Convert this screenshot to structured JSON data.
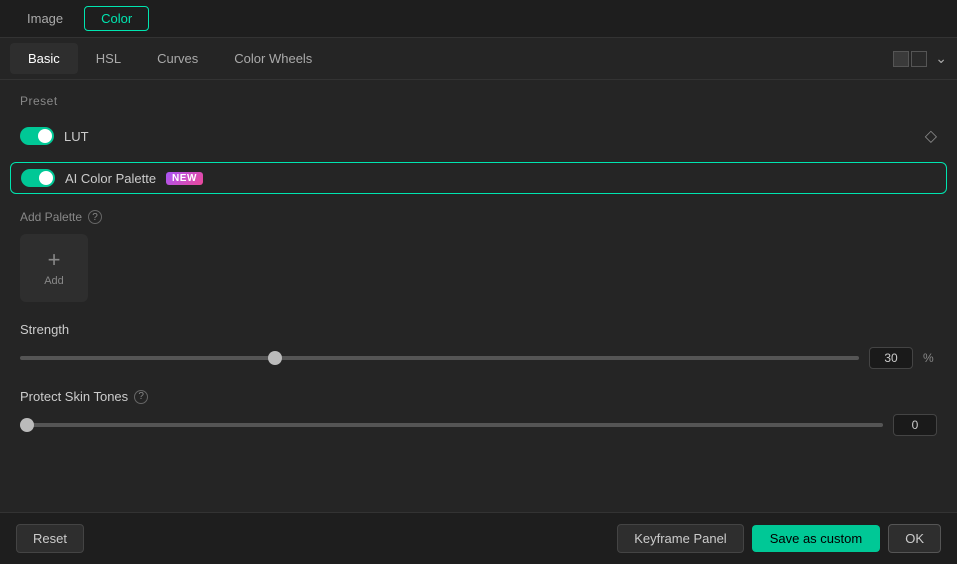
{
  "topTabs": [
    {
      "label": "Image",
      "active": false
    },
    {
      "label": "Color",
      "active": true
    }
  ],
  "subTabs": [
    {
      "label": "Basic",
      "active": true
    },
    {
      "label": "HSL",
      "active": false
    },
    {
      "label": "Curves",
      "active": false
    },
    {
      "label": "Color Wheels",
      "active": false
    }
  ],
  "section": {
    "presetLabel": "Preset",
    "lut": {
      "label": "LUT",
      "enabled": true
    },
    "aiColorPalette": {
      "label": "AI Color Palette",
      "badgeLabel": "NEW",
      "enabled": true
    },
    "addPalette": {
      "label": "Add Palette",
      "addButtonLabel": "Add"
    },
    "strength": {
      "label": "Strength",
      "value": "30",
      "unit": "%",
      "sliderPercent": 30
    },
    "protectSkinTones": {
      "label": "Protect Skin Tones",
      "value": "0",
      "sliderPercent": 0
    }
  },
  "bottomBar": {
    "resetLabel": "Reset",
    "keyframePanelLabel": "Keyframe Panel",
    "saveAsCustomLabel": "Save as custom",
    "okLabel": "OK"
  }
}
